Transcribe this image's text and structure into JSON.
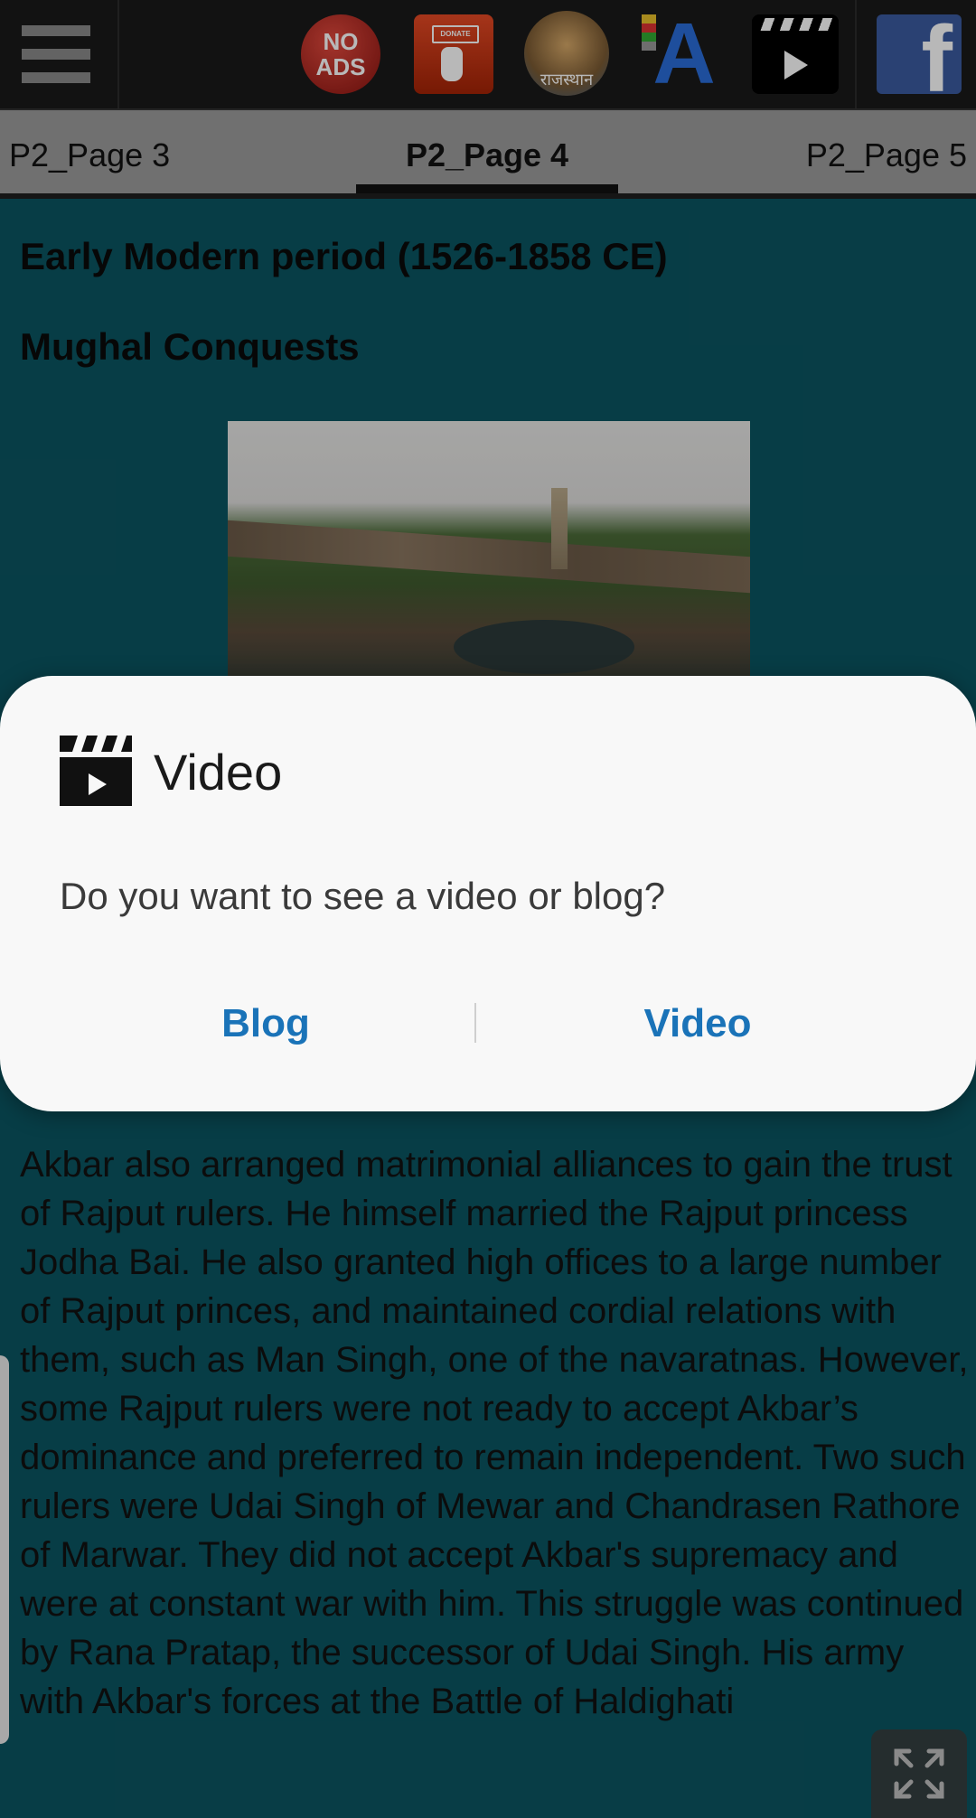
{
  "toolbar": {
    "no_ads_label": "NO ADS",
    "donate_label": "DONATE",
    "rajasthan_label": "राजस्थान",
    "font_label": "A",
    "facebook_label": "f"
  },
  "tabs": [
    {
      "label": "P2_Page 3",
      "selected": false
    },
    {
      "label": "P2_Page 4",
      "selected": true
    },
    {
      "label": "P2_Page 5",
      "selected": false
    }
  ],
  "content": {
    "heading": "Early Modern period (1526-1858 CE)",
    "subheading": "Mughal Conquests",
    "body": "Akbar also arranged matrimonial alliances to gain the trust of Rajput rulers. He himself married the Rajput princess Jodha Bai. He also granted high offices to a large number of Rajput princes, and maintained cordial relations with them, such as Man Singh, one of the navaratnas. However, some Rajput rulers were not ready to accept Akbar’s dominance and preferred to remain independent. Two such rulers were Udai Singh of Mewar and Chandrasen Rathore of Marwar. They did not accept Akbar's supremacy and were at constant war with him. This struggle was continued by Rana Pratap, the successor of Udai Singh. His army with Akbar's forces at the Battle of Haldighati"
  },
  "dialog": {
    "icon": "clapperboard-icon",
    "title": "Video",
    "message": "Do you want to see a video or blog?",
    "buttons": {
      "blog": "Blog",
      "video": "Video"
    },
    "accent_color": "#1a73b8"
  },
  "colors": {
    "background": "#0b5561",
    "toolbar": "#1a1a1a",
    "tabbar": "#9b9b9b"
  }
}
